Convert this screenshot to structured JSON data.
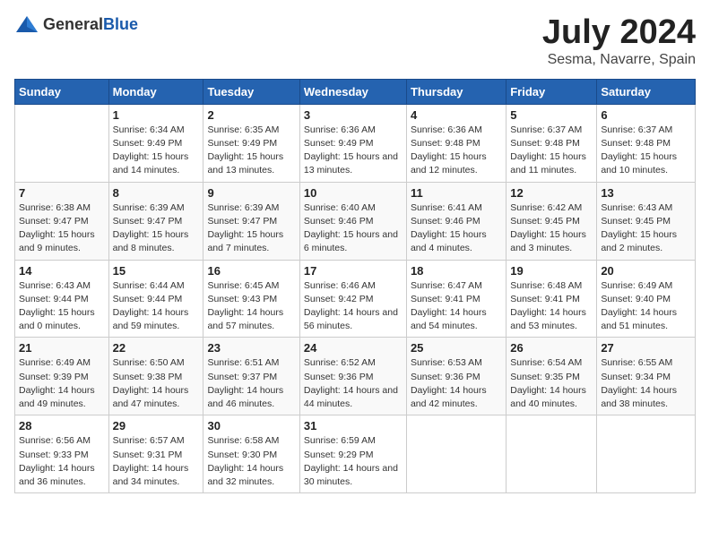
{
  "header": {
    "logo_general": "General",
    "logo_blue": "Blue",
    "month": "July 2024",
    "location": "Sesma, Navarre, Spain"
  },
  "weekdays": [
    "Sunday",
    "Monday",
    "Tuesday",
    "Wednesday",
    "Thursday",
    "Friday",
    "Saturday"
  ],
  "weeks": [
    [
      {
        "day": "",
        "sunrise": "",
        "sunset": "",
        "daylight": ""
      },
      {
        "day": "1",
        "sunrise": "Sunrise: 6:34 AM",
        "sunset": "Sunset: 9:49 PM",
        "daylight": "Daylight: 15 hours and 14 minutes."
      },
      {
        "day": "2",
        "sunrise": "Sunrise: 6:35 AM",
        "sunset": "Sunset: 9:49 PM",
        "daylight": "Daylight: 15 hours and 13 minutes."
      },
      {
        "day": "3",
        "sunrise": "Sunrise: 6:36 AM",
        "sunset": "Sunset: 9:49 PM",
        "daylight": "Daylight: 15 hours and 13 minutes."
      },
      {
        "day": "4",
        "sunrise": "Sunrise: 6:36 AM",
        "sunset": "Sunset: 9:48 PM",
        "daylight": "Daylight: 15 hours and 12 minutes."
      },
      {
        "day": "5",
        "sunrise": "Sunrise: 6:37 AM",
        "sunset": "Sunset: 9:48 PM",
        "daylight": "Daylight: 15 hours and 11 minutes."
      },
      {
        "day": "6",
        "sunrise": "Sunrise: 6:37 AM",
        "sunset": "Sunset: 9:48 PM",
        "daylight": "Daylight: 15 hours and 10 minutes."
      }
    ],
    [
      {
        "day": "7",
        "sunrise": "Sunrise: 6:38 AM",
        "sunset": "Sunset: 9:47 PM",
        "daylight": "Daylight: 15 hours and 9 minutes."
      },
      {
        "day": "8",
        "sunrise": "Sunrise: 6:39 AM",
        "sunset": "Sunset: 9:47 PM",
        "daylight": "Daylight: 15 hours and 8 minutes."
      },
      {
        "day": "9",
        "sunrise": "Sunrise: 6:39 AM",
        "sunset": "Sunset: 9:47 PM",
        "daylight": "Daylight: 15 hours and 7 minutes."
      },
      {
        "day": "10",
        "sunrise": "Sunrise: 6:40 AM",
        "sunset": "Sunset: 9:46 PM",
        "daylight": "Daylight: 15 hours and 6 minutes."
      },
      {
        "day": "11",
        "sunrise": "Sunrise: 6:41 AM",
        "sunset": "Sunset: 9:46 PM",
        "daylight": "Daylight: 15 hours and 4 minutes."
      },
      {
        "day": "12",
        "sunrise": "Sunrise: 6:42 AM",
        "sunset": "Sunset: 9:45 PM",
        "daylight": "Daylight: 15 hours and 3 minutes."
      },
      {
        "day": "13",
        "sunrise": "Sunrise: 6:43 AM",
        "sunset": "Sunset: 9:45 PM",
        "daylight": "Daylight: 15 hours and 2 minutes."
      }
    ],
    [
      {
        "day": "14",
        "sunrise": "Sunrise: 6:43 AM",
        "sunset": "Sunset: 9:44 PM",
        "daylight": "Daylight: 15 hours and 0 minutes."
      },
      {
        "day": "15",
        "sunrise": "Sunrise: 6:44 AM",
        "sunset": "Sunset: 9:44 PM",
        "daylight": "Daylight: 14 hours and 59 minutes."
      },
      {
        "day": "16",
        "sunrise": "Sunrise: 6:45 AM",
        "sunset": "Sunset: 9:43 PM",
        "daylight": "Daylight: 14 hours and 57 minutes."
      },
      {
        "day": "17",
        "sunrise": "Sunrise: 6:46 AM",
        "sunset": "Sunset: 9:42 PM",
        "daylight": "Daylight: 14 hours and 56 minutes."
      },
      {
        "day": "18",
        "sunrise": "Sunrise: 6:47 AM",
        "sunset": "Sunset: 9:41 PM",
        "daylight": "Daylight: 14 hours and 54 minutes."
      },
      {
        "day": "19",
        "sunrise": "Sunrise: 6:48 AM",
        "sunset": "Sunset: 9:41 PM",
        "daylight": "Daylight: 14 hours and 53 minutes."
      },
      {
        "day": "20",
        "sunrise": "Sunrise: 6:49 AM",
        "sunset": "Sunset: 9:40 PM",
        "daylight": "Daylight: 14 hours and 51 minutes."
      }
    ],
    [
      {
        "day": "21",
        "sunrise": "Sunrise: 6:49 AM",
        "sunset": "Sunset: 9:39 PM",
        "daylight": "Daylight: 14 hours and 49 minutes."
      },
      {
        "day": "22",
        "sunrise": "Sunrise: 6:50 AM",
        "sunset": "Sunset: 9:38 PM",
        "daylight": "Daylight: 14 hours and 47 minutes."
      },
      {
        "day": "23",
        "sunrise": "Sunrise: 6:51 AM",
        "sunset": "Sunset: 9:37 PM",
        "daylight": "Daylight: 14 hours and 46 minutes."
      },
      {
        "day": "24",
        "sunrise": "Sunrise: 6:52 AM",
        "sunset": "Sunset: 9:36 PM",
        "daylight": "Daylight: 14 hours and 44 minutes."
      },
      {
        "day": "25",
        "sunrise": "Sunrise: 6:53 AM",
        "sunset": "Sunset: 9:36 PM",
        "daylight": "Daylight: 14 hours and 42 minutes."
      },
      {
        "day": "26",
        "sunrise": "Sunrise: 6:54 AM",
        "sunset": "Sunset: 9:35 PM",
        "daylight": "Daylight: 14 hours and 40 minutes."
      },
      {
        "day": "27",
        "sunrise": "Sunrise: 6:55 AM",
        "sunset": "Sunset: 9:34 PM",
        "daylight": "Daylight: 14 hours and 38 minutes."
      }
    ],
    [
      {
        "day": "28",
        "sunrise": "Sunrise: 6:56 AM",
        "sunset": "Sunset: 9:33 PM",
        "daylight": "Daylight: 14 hours and 36 minutes."
      },
      {
        "day": "29",
        "sunrise": "Sunrise: 6:57 AM",
        "sunset": "Sunset: 9:31 PM",
        "daylight": "Daylight: 14 hours and 34 minutes."
      },
      {
        "day": "30",
        "sunrise": "Sunrise: 6:58 AM",
        "sunset": "Sunset: 9:30 PM",
        "daylight": "Daylight: 14 hours and 32 minutes."
      },
      {
        "day": "31",
        "sunrise": "Sunrise: 6:59 AM",
        "sunset": "Sunset: 9:29 PM",
        "daylight": "Daylight: 14 hours and 30 minutes."
      },
      {
        "day": "",
        "sunrise": "",
        "sunset": "",
        "daylight": ""
      },
      {
        "day": "",
        "sunrise": "",
        "sunset": "",
        "daylight": ""
      },
      {
        "day": "",
        "sunrise": "",
        "sunset": "",
        "daylight": ""
      }
    ]
  ]
}
